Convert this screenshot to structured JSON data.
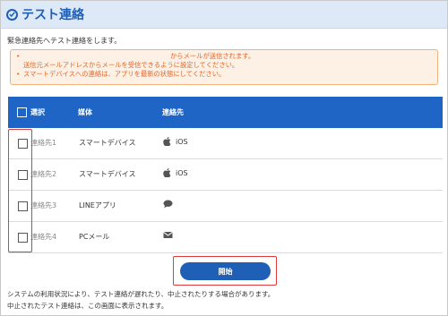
{
  "header": {
    "title": "テスト連絡",
    "icon": "check-circle-icon"
  },
  "description": "緊急連絡先へテスト連絡をします。",
  "notice": {
    "lines": [
      "からメールが送信されます。",
      "送信元メールアドレスからメールを受信できるように設定してください。",
      "スマートデバイスへの連絡は、アプリを最新の状態にしてください。"
    ],
    "bullet": "•"
  },
  "table": {
    "headers": {
      "select": "選択",
      "medium": "媒体",
      "contact": "連絡先"
    },
    "rows": [
      {
        "name": "連絡先1",
        "medium": "スマートデバイス",
        "icon": "apple-icon",
        "contact_label": "iOS"
      },
      {
        "name": "連絡先2",
        "medium": "スマートデバイス",
        "icon": "apple-icon",
        "contact_label": "iOS"
      },
      {
        "name": "連絡先3",
        "medium": "LINEアプリ",
        "icon": "chat-bubble-icon",
        "contact_label": ""
      },
      {
        "name": "連絡先4",
        "medium": "PCメール",
        "icon": "envelope-icon",
        "contact_label": ""
      }
    ]
  },
  "start_button": {
    "label": "開始"
  },
  "footer": {
    "line1": "システムの利用状況により、テスト連絡が遅れたり、中止されたりする場合があります。",
    "line2": "中止されたテスト連絡は、この画面に表示されます。"
  },
  "colors": {
    "accent": "#1f5fb5",
    "header_bg": "#dde9f6",
    "table_head": "#1f65c6",
    "notice_bg": "#fdf0e4",
    "notice_text": "#e2672a",
    "highlight": "#e23b3b"
  }
}
